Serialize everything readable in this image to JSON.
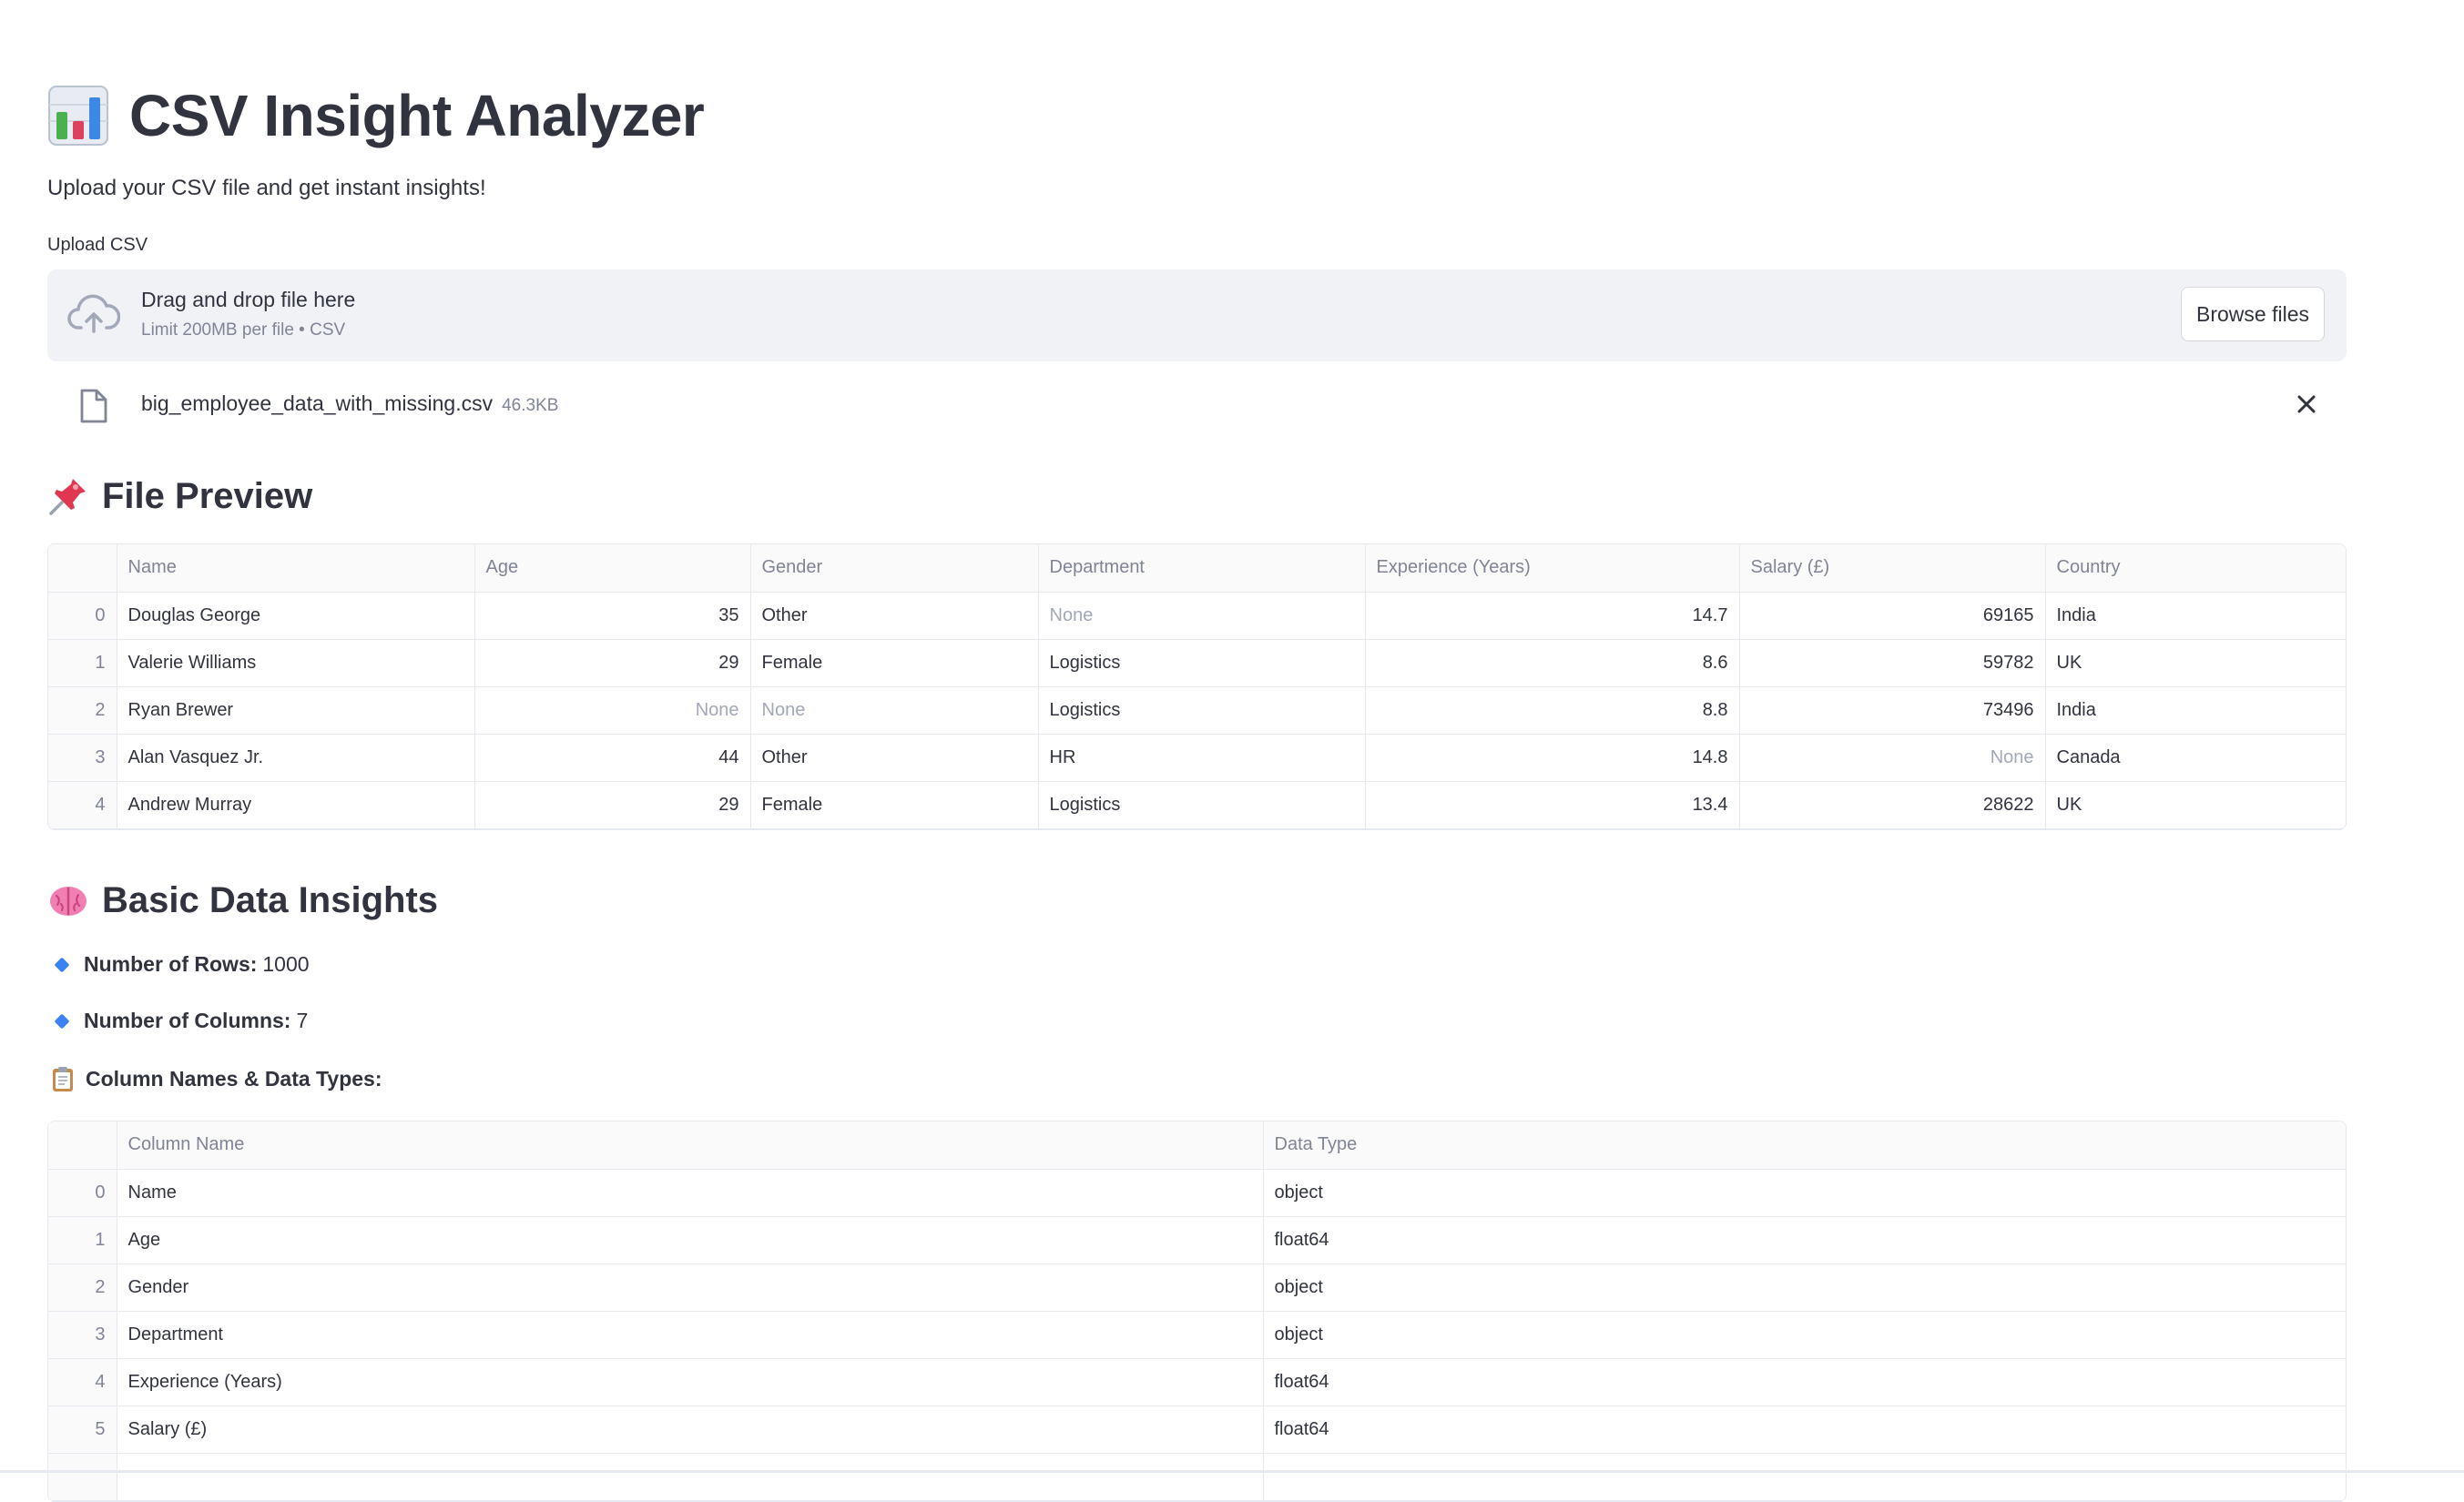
{
  "header": {
    "title": "CSV Insight Analyzer",
    "title_icon": "bar-chart-emoji",
    "subtitle": "Upload your CSV file and get instant insights!"
  },
  "uploader": {
    "label": "Upload CSV",
    "drop_text": "Drag and drop file here",
    "limit_text": "Limit 200MB per file • CSV",
    "browse_label": "Browse files",
    "file_name": "big_employee_data_with_missing.csv",
    "file_size": "46.3KB"
  },
  "preview": {
    "heading": "File Preview",
    "heading_icon": "pushpin-emoji",
    "columns": [
      "Name",
      "Age",
      "Gender",
      "Department",
      "Experience (Years)",
      "Salary (£)",
      "Country"
    ],
    "rows": [
      {
        "index": "0",
        "cells": [
          "Douglas George",
          "35",
          "Other",
          "None",
          "14.7",
          "69165",
          "India"
        ]
      },
      {
        "index": "1",
        "cells": [
          "Valerie Williams",
          "29",
          "Female",
          "Logistics",
          "8.6",
          "59782",
          "UK"
        ]
      },
      {
        "index": "2",
        "cells": [
          "Ryan Brewer",
          "None",
          "None",
          "Logistics",
          "8.8",
          "73496",
          "India"
        ]
      },
      {
        "index": "3",
        "cells": [
          "Alan Vasquez Jr.",
          "44",
          "Other",
          "HR",
          "14.8",
          "None",
          "Canada"
        ]
      },
      {
        "index": "4",
        "cells": [
          "Andrew Murray",
          "29",
          "Female",
          "Logistics",
          "13.4",
          "28622",
          "UK"
        ]
      }
    ]
  },
  "insights": {
    "heading": "Basic Data Insights",
    "heading_icon": "brain-emoji",
    "rows_label": "Number of Rows:",
    "rows_value": "1000",
    "cols_label": "Number of Columns:",
    "cols_value": "7",
    "types_heading": "Column Names & Data Types:",
    "types_icon": "clipboard-emoji",
    "types_columns": [
      "Column Name",
      "Data Type"
    ],
    "types_rows": [
      {
        "index": "0",
        "name": "Name",
        "type": "object"
      },
      {
        "index": "1",
        "name": "Age",
        "type": "float64"
      },
      {
        "index": "2",
        "name": "Gender",
        "type": "object"
      },
      {
        "index": "3",
        "name": "Department",
        "type": "object"
      },
      {
        "index": "4",
        "name": "Experience (Years)",
        "type": "float64"
      },
      {
        "index": "5",
        "name": "Salary (£)",
        "type": "float64"
      }
    ]
  },
  "colors": {
    "text": "#31333f",
    "muted": "#808495",
    "dropzone_bg": "#f0f2f6",
    "bullet_blue": "#3b82f6"
  }
}
